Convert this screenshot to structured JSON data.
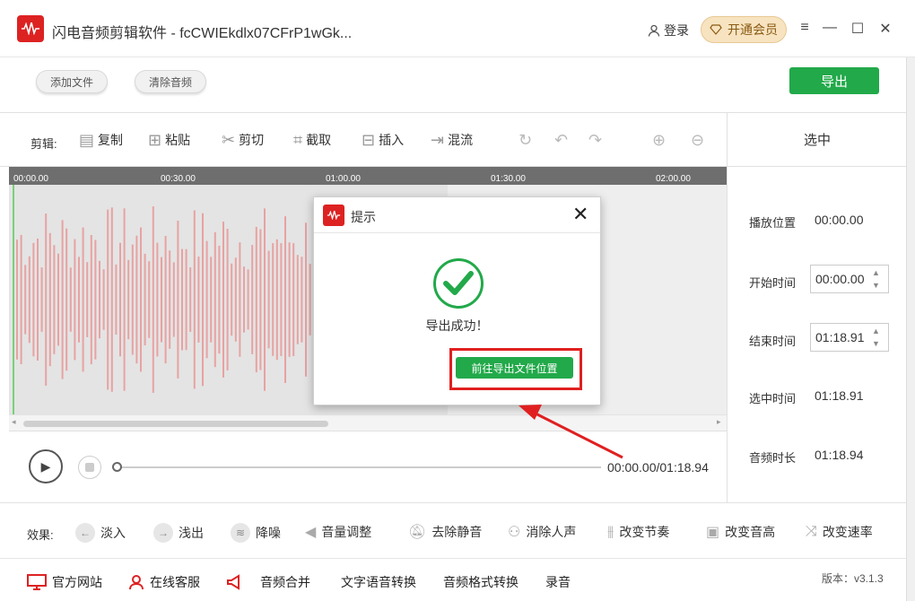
{
  "titlebar": {
    "title": "闪电音频剪辑软件 - fcCWIEkdlx07CFrP1wGk...",
    "login": "登录",
    "vip": "开通会员",
    "window_controls": [
      "≡",
      "—",
      "☐",
      "✕"
    ]
  },
  "topbar": {
    "add_file": "添加文件",
    "clear_audio": "清除音频",
    "export": "导出"
  },
  "editbar": {
    "label": "剪辑:",
    "tools": [
      "复制",
      "粘贴",
      "剪切",
      "截取",
      "插入",
      "混流"
    ]
  },
  "timeline": {
    "ticks": [
      "00:00.00",
      "00:30.00",
      "01:00.00",
      "01:30.00",
      "02:00.00"
    ]
  },
  "player": {
    "time": "00:00.00/01:18.94"
  },
  "right_panel": {
    "title": "选中",
    "play_pos_label": "播放位置",
    "play_pos": "00:00.00",
    "start_label": "开始时间",
    "start": "00:00.00",
    "end_label": "结束时间",
    "end": "01:18.91",
    "sel_label": "选中时间",
    "sel": "01:18.91",
    "dur_label": "音频时长",
    "dur": "01:18.94"
  },
  "effects": {
    "label": "效果:",
    "items": [
      "淡入",
      "浅出",
      "降噪",
      "音量调整",
      "去除静音",
      "消除人声",
      "改变节奏",
      "改变音高",
      "改变速率"
    ]
  },
  "footer": {
    "links": [
      "官方网站",
      "在线客服",
      "音频合并",
      "文字语音转换",
      "音频格式转换",
      "录音"
    ],
    "version": "版本：v3.1.3"
  },
  "dialog": {
    "title": "提示",
    "message": "导出成功！",
    "button": "前往导出文件位置"
  },
  "colors": {
    "accent_green": "#22a94a",
    "brand_red": "#d22222",
    "highlight_red": "#e02020",
    "waveform": "#e8a2a2"
  }
}
